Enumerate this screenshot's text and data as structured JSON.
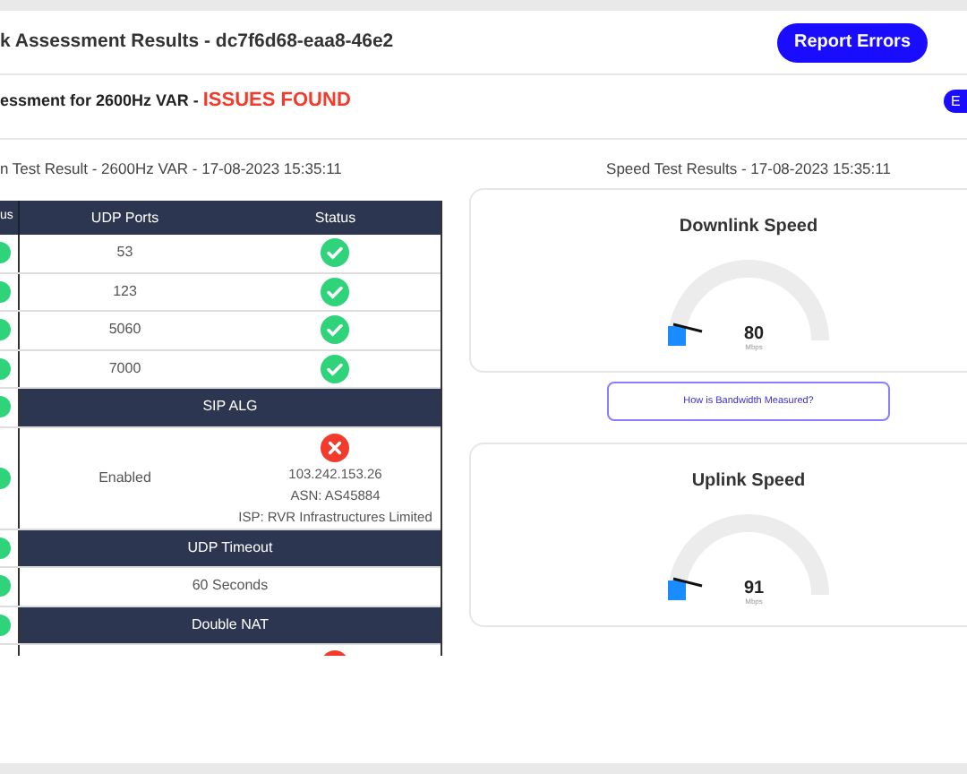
{
  "header": {
    "title": "k Assessment Results - dc7f6d68-eaa8-46e2",
    "button": "Report Errors"
  },
  "assessment": {
    "title": "essment for 2600Hz VAR - ",
    "status": "ISSUES FOUND",
    "button": "E"
  },
  "udp_section": {
    "title": "n Test Result - 2600Hz VAR - 17-08-2023 15:35:11",
    "columns": [
      "us",
      "UDP Ports",
      "Status"
    ],
    "rows": [
      {
        "kind": "port",
        "check_ok": true,
        "value": "53",
        "passed": true
      },
      {
        "kind": "port",
        "check_ok": true,
        "value": "123",
        "passed": true
      },
      {
        "kind": "port",
        "check_ok": true,
        "value": "5060",
        "passed": true
      },
      {
        "kind": "port",
        "check_ok": true,
        "value": "7000",
        "passed": true
      },
      {
        "kind": "section",
        "check_ok": true,
        "label": "SIP ALG"
      },
      {
        "kind": "detail",
        "check_ok": true,
        "value": "Enabled",
        "passed": false,
        "lines": [
          "103.242.153.26",
          "ASN: AS45884",
          "ISP: RVR Infrastructures Limited"
        ]
      },
      {
        "kind": "section",
        "check_ok": true,
        "label": "UDP Timeout"
      },
      {
        "kind": "full",
        "check_ok": true,
        "label": "60 Seconds"
      },
      {
        "kind": "section",
        "check_ok": true,
        "label": "Double NAT"
      },
      {
        "kind": "detail",
        "passed": false
      }
    ]
  },
  "speed_section": {
    "title": "Speed Test Results - 17-08-2023 15:35:11",
    "cards": [
      {
        "kind": "gauge",
        "title": "Downlink Speed",
        "value": "80",
        "unit": "Mbps"
      },
      {
        "kind": "link",
        "label": "How is Bandwidth Measured?"
      },
      {
        "kind": "gauge",
        "title": "Uplink Speed",
        "value": "91",
        "unit": "Mbps"
      }
    ]
  }
}
